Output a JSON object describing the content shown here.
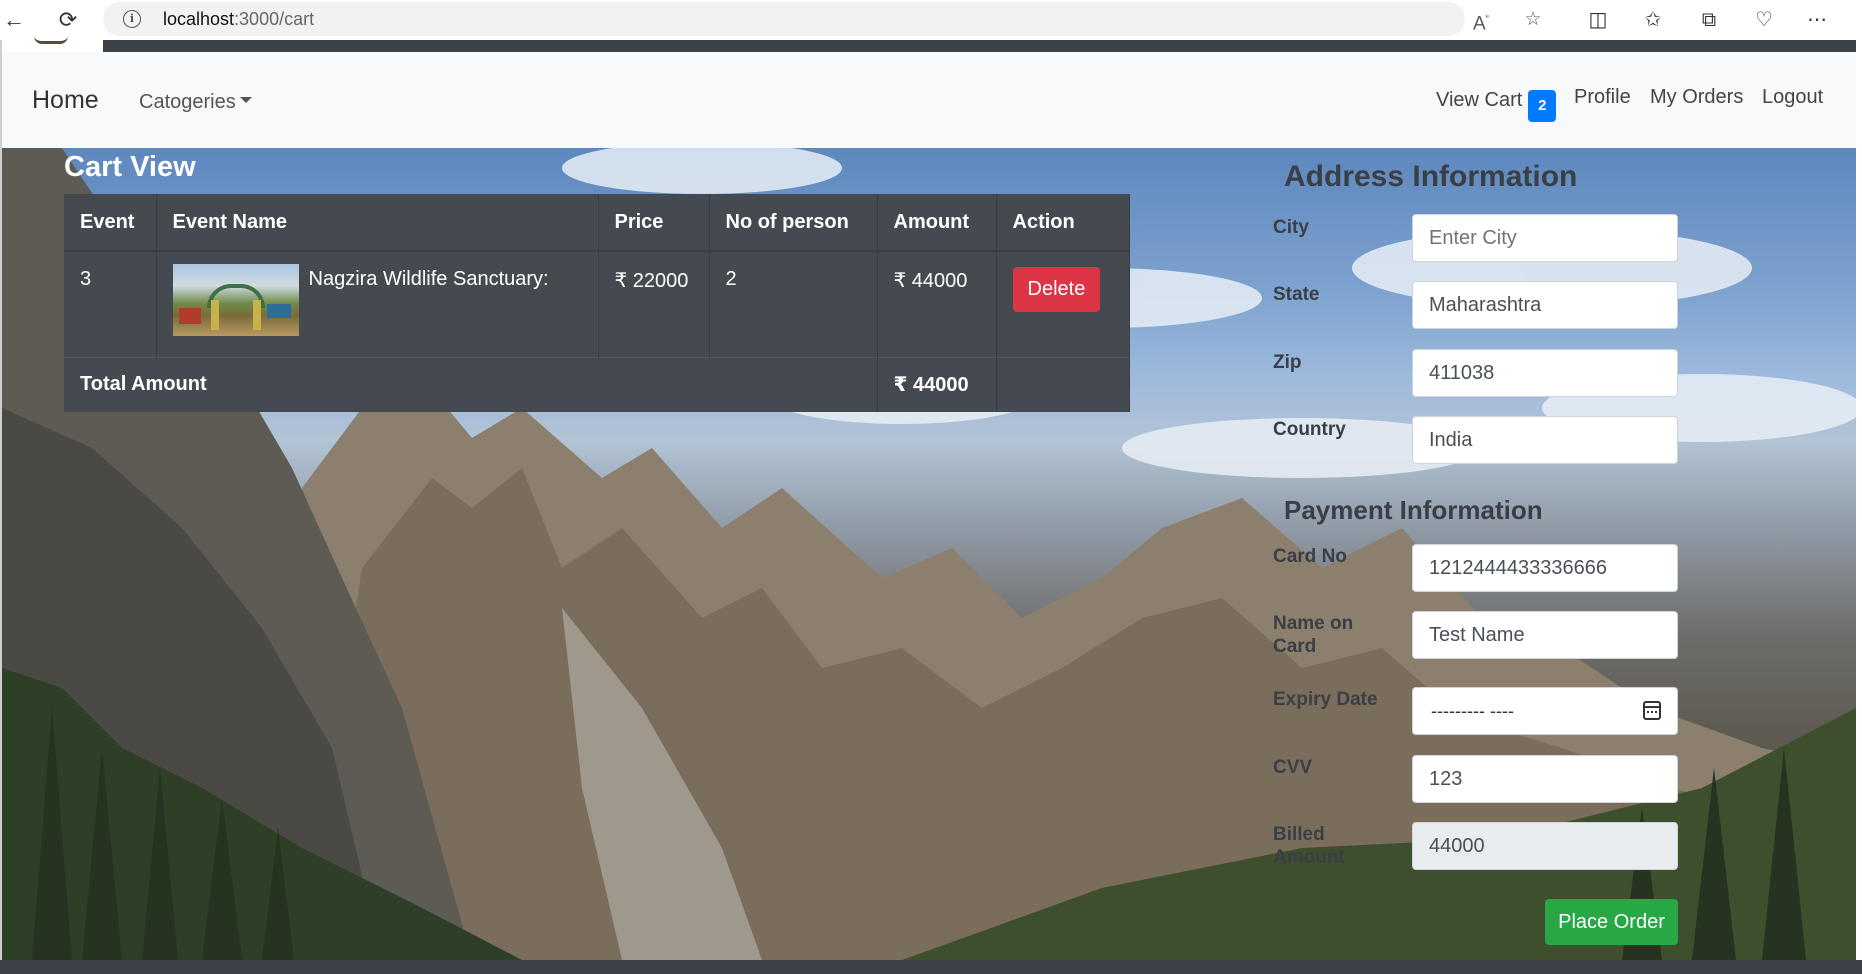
{
  "browser": {
    "url_host": "localhost",
    "url_path": ":3000/cart",
    "icons": [
      "back-arrow-icon",
      "reload-icon",
      "info-icon",
      "read-aloud-icon",
      "favorite-star-icon",
      "split-screen-icon",
      "favorites-icon",
      "collections-icon",
      "browser-essentials-icon",
      "more-icon"
    ]
  },
  "navbar": {
    "home": "Home",
    "categories": "Catogeries",
    "view_cart": "View Cart",
    "cart_count": "2",
    "profile": "Profile",
    "my_orders": "My Orders",
    "logout": "Logout"
  },
  "cart": {
    "title": "Cart View",
    "headers": [
      "Event",
      "Event Name",
      "Price",
      "No of person",
      "Amount",
      "Action"
    ],
    "rows": [
      {
        "event": "3",
        "event_name": "Nagzira Wildlife Sanctuary:",
        "price": "₹ 22000",
        "persons": "2",
        "amount": "₹ 44000",
        "action": "Delete"
      }
    ],
    "total_label": "Total Amount",
    "total_amount": "₹ 44000"
  },
  "address": {
    "title": "Address Information",
    "city_label": "City",
    "city_placeholder": "Enter City",
    "state_label": "State",
    "state_value": "Maharashtra",
    "zip_label": "Zip",
    "zip_value": "411038",
    "country_label": "Country",
    "country_value": "India"
  },
  "payment": {
    "title": "Payment Information",
    "card_no_label": "Card No",
    "card_no_value": "1212444433336666",
    "name_label": "Name on Card",
    "name_value": "Test Name",
    "expiry_label": "Expiry Date",
    "expiry_value": "--------- ----",
    "cvv_label": "CVV",
    "cvv_value": "123",
    "billed_label": "Billed Amount",
    "billed_value": "44000",
    "submit": "Place Order"
  },
  "colors": {
    "primary": "#007bff",
    "danger": "#dc3545",
    "success": "#28a745",
    "table_dark": "#454950",
    "navbar_bg": "#f8f9fa"
  }
}
